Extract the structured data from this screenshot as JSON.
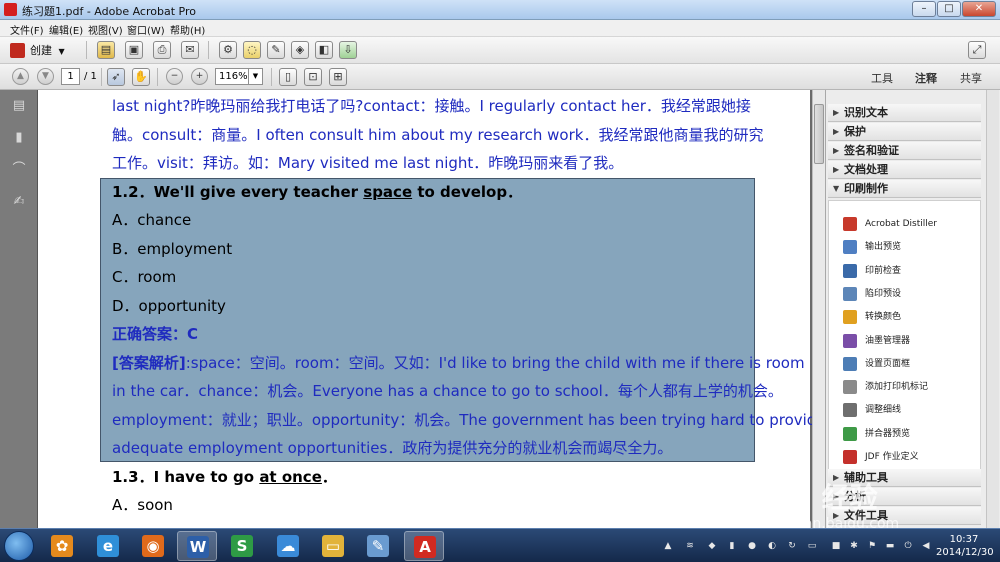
{
  "window": {
    "title": "练习题1.pdf - Adobe Acrobat Pro",
    "controls": {
      "minimize": "–",
      "maximize": "□",
      "close": "✕"
    }
  },
  "menu": [
    "文件(F)",
    "编辑(E)",
    "视图(V)",
    "窗口(W)",
    "帮助(H)"
  ],
  "toolbar": {
    "create_label": "创建",
    "page_current": "1",
    "page_total": "/ 1",
    "zoom_value": "116%",
    "panel_tabs": {
      "tools": "工具",
      "comment": "注释",
      "share": "共享"
    }
  },
  "document": {
    "lines": [
      "last night?昨晚玛丽给我打电话了吗?contact：接触。I regularly contact her．我经常跟她接",
      "触。consult：商量。I often consult him about my research work．我经常跟他商量我的研究",
      "工作。visit：拜访。如：Mary visited me last night．昨晚玛丽来看了我。"
    ],
    "q12": {
      "prefix": "1.2．We'll give every teacher ",
      "keyword": "space",
      "suffix": " to develop．",
      "options": [
        "A．chance",
        "B．employment",
        "C．room",
        "D．opportunity"
      ],
      "answer_label": "正确答案：",
      "answer": "C",
      "analysis_label": "[答案解析]",
      "analysis_lines": [
        ":space：空间。room：空间。又如：I'd like to bring the child with me if there is room",
        "in the car．chance：机会。Everyone has a chance to go to school．每个人都有上学的机会。",
        "employment：就业；职业。opportunity：机会。The government has been trying hard to provide",
        "adequate employment opportunities．政府为提供充分的就业机会而竭尽全力。"
      ]
    },
    "q13": {
      "prefix": "1.3．I have to go ",
      "keyword": "at once",
      "suffix": "．",
      "options": [
        "A．soon"
      ]
    }
  },
  "right_panel": {
    "sections": [
      "识别文本",
      "保护",
      "签名和验证",
      "文档处理",
      "印刷制作"
    ],
    "print_tools": [
      {
        "label": "Acrobat Distiller",
        "icon": "distiller-icon",
        "color": "#c7392b"
      },
      {
        "label": "输出预览",
        "icon": "output-preview-icon",
        "color": "#4f7fc2"
      },
      {
        "label": "印前检查",
        "icon": "preflight-icon",
        "color": "#3a6aa9"
      },
      {
        "label": "陷印预设",
        "icon": "trap-preset-icon",
        "color": "#5d86b8"
      },
      {
        "label": "转换颜色",
        "icon": "convert-colors-icon",
        "color": "#e0a020"
      },
      {
        "label": "油墨管理器",
        "icon": "ink-manager-icon",
        "color": "#7a4ea8"
      },
      {
        "label": "设置页面框",
        "icon": "page-boxes-icon",
        "color": "#4d7db5"
      },
      {
        "label": "添加打印机标记",
        "icon": "printer-marks-icon",
        "color": "#8a8a8a"
      },
      {
        "label": "调整细线",
        "icon": "fix-hairlines-icon",
        "color": "#6e6e6e"
      },
      {
        "label": "拼合器预览",
        "icon": "flattener-preview-icon",
        "color": "#3e9a47"
      },
      {
        "label": "JDF 作业定义",
        "icon": "jdf-icon",
        "color": "#c4302b"
      }
    ],
    "bottom_sections": [
      "辅助工具",
      "分析",
      "文件工具"
    ]
  },
  "watermark": {
    "main": "Bai 经验",
    "sub": "jingyan.baidu.com"
  },
  "taskbar": {
    "apps": [
      {
        "name": "pinwheel",
        "color": "#e58a1d",
        "glyph": "✿"
      },
      {
        "name": "browser-360",
        "color": "#2f8fd8",
        "glyph": "e"
      },
      {
        "name": "firefox",
        "color": "#e06a1b",
        "glyph": "◉"
      },
      {
        "name": "word",
        "color": "#2d5fa8",
        "glyph": "W"
      },
      {
        "name": "spreadsheet",
        "color": "#2e9b45",
        "glyph": "S"
      },
      {
        "name": "cloud",
        "color": "#3a8ad8",
        "glyph": "☁"
      },
      {
        "name": "explorer",
        "color": "#e2b33a",
        "glyph": "▭"
      },
      {
        "name": "paint",
        "color": "#6a9bd0",
        "glyph": "✎"
      },
      {
        "name": "acrobat",
        "color": "#d12a21",
        "glyph": "A"
      }
    ],
    "time": "10:37",
    "date": "2014/12/30"
  }
}
